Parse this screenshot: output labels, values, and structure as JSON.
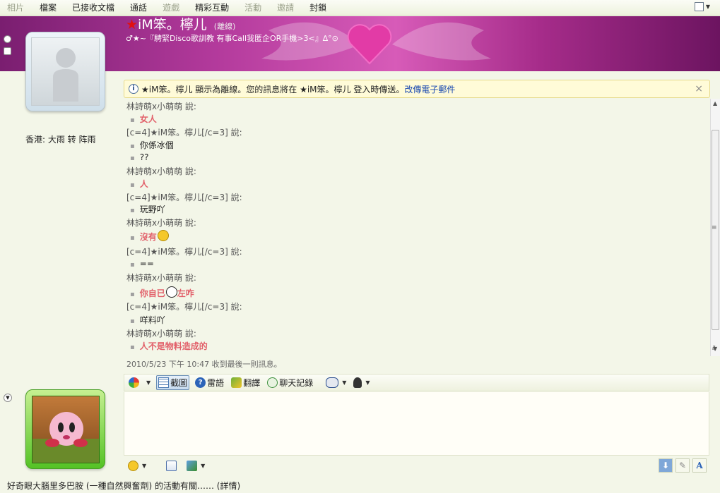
{
  "menu": {
    "items": [
      {
        "label": "相片",
        "dim": true
      },
      {
        "label": "檔案",
        "dim": false
      },
      {
        "label": "已接收文檔",
        "dim": false
      },
      {
        "label": "通話",
        "dim": false
      },
      {
        "label": "遊戲",
        "dim": true
      },
      {
        "label": "精彩互動",
        "dim": false
      },
      {
        "label": "活動",
        "dim": true
      },
      {
        "label": "邀請",
        "dim": true
      },
      {
        "label": "封鎖",
        "dim": false
      }
    ]
  },
  "contact": {
    "star": "★",
    "name": "iM笨。檸儿",
    "status": "(離線)",
    "personal_message": "♂★~『騁緊Disco歌訓教 有事Call我匿企OR手機>3<』∆°⊙"
  },
  "weather": "香港: 大雨 转 阵雨",
  "infobar": {
    "text": "★iM笨。檸儿 顯示為離線。您的訊息將在 ★iM笨。檸儿 登入時傳送。",
    "link": "改傳電子郵件",
    "close": "×"
  },
  "conversation": [
    {
      "type": "speaker",
      "text": "林詩萌x小萌萌 說:"
    },
    {
      "type": "msg",
      "style": "red",
      "text": "女人"
    },
    {
      "type": "speaker",
      "text": "[c=4]★iM笨。檸儿[/c=3] 說:"
    },
    {
      "type": "msg",
      "style": "normal",
      "text": "你係冰個"
    },
    {
      "type": "msg",
      "style": "normal",
      "text": "??"
    },
    {
      "type": "speaker",
      "text": "林詩萌x小萌萌 說:"
    },
    {
      "type": "msg",
      "style": "red",
      "text": "人"
    },
    {
      "type": "speaker",
      "text": "[c=4]★iM笨。檸儿[/c=3] 說:"
    },
    {
      "type": "msg",
      "style": "normal",
      "text": "玩野吖"
    },
    {
      "type": "speaker",
      "text": "林詩萌x小萌萌 說:"
    },
    {
      "type": "msg",
      "style": "red",
      "text": "沒有",
      "emoticon": "sad-emoticon"
    },
    {
      "type": "speaker",
      "text": "[c=4]★iM笨。檸儿[/c=3] 說:"
    },
    {
      "type": "msg",
      "style": "normal",
      "text": "=="
    },
    {
      "type": "speaker",
      "text": "林詩萌x小萌萌 說:"
    },
    {
      "type": "msg",
      "style": "red",
      "text": "你自已",
      "emoticon": "grin-emoticon",
      "text_after": "左咋"
    },
    {
      "type": "speaker",
      "text": "[c=4]★iM笨。檸儿[/c=3] 說:"
    },
    {
      "type": "msg",
      "style": "normal",
      "text": "咩料吖"
    },
    {
      "type": "speaker",
      "text": "林詩萌x小萌萌 說:"
    },
    {
      "type": "msg",
      "style": "red",
      "text": "人不是物料造成的"
    }
  ],
  "last_message_time": "2010/5/23 下午 10:47 收到最後一則訊息。",
  "toolbar": {
    "screenshot_label": "截圖",
    "dictionary_label": "雷語",
    "translate_label": "翻譯",
    "history_label": "聊天記錄"
  },
  "bottom_icons": {
    "font": "A"
  },
  "ad_line": "好奇眼大腦里多巴胺 (一種自然興奮劑) 的活動有關…… (詳情)",
  "colors": {
    "accent_red": "#e2606a",
    "link_blue": "#1a49b0",
    "banner_purple": "#b33a9c"
  }
}
